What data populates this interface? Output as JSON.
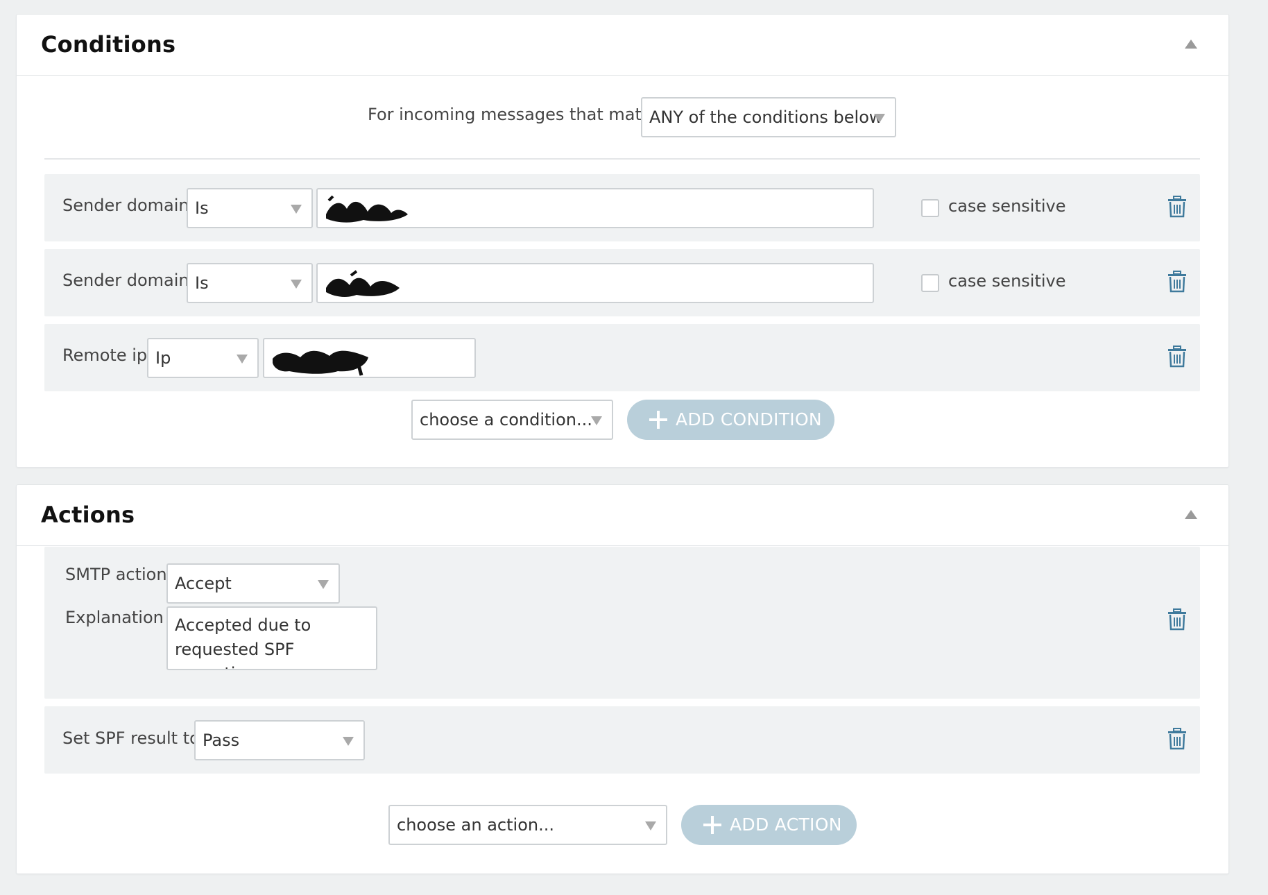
{
  "conditions": {
    "title": "Conditions",
    "match_label": "For incoming messages that match",
    "match_select": "ANY of the conditions below",
    "rows": [
      {
        "label": "Sender domain",
        "operator": "Is",
        "checkbox_label": "case sensitive"
      },
      {
        "label": "Sender domain",
        "operator": "Is",
        "checkbox_label": "case sensitive"
      },
      {
        "label": "Remote ip",
        "operator": "Ip"
      }
    ],
    "choose_placeholder": "choose a condition...",
    "add_button": "ADD CONDITION"
  },
  "actions": {
    "title": "Actions",
    "smtp_label": "SMTP action",
    "smtp_value": "Accept",
    "explanation_label": "Explanation",
    "explanation_value": "Accepted due to requested SPF exception",
    "spf_label": "Set SPF result to",
    "spf_value": "Pass",
    "choose_placeholder": "choose an action...",
    "add_button": "ADD ACTION"
  },
  "colors": {
    "background": "#eef0f1",
    "row_background": "#f0f2f3",
    "button_background": "#b9cfda",
    "trash_icon": "#3f7a9c"
  }
}
